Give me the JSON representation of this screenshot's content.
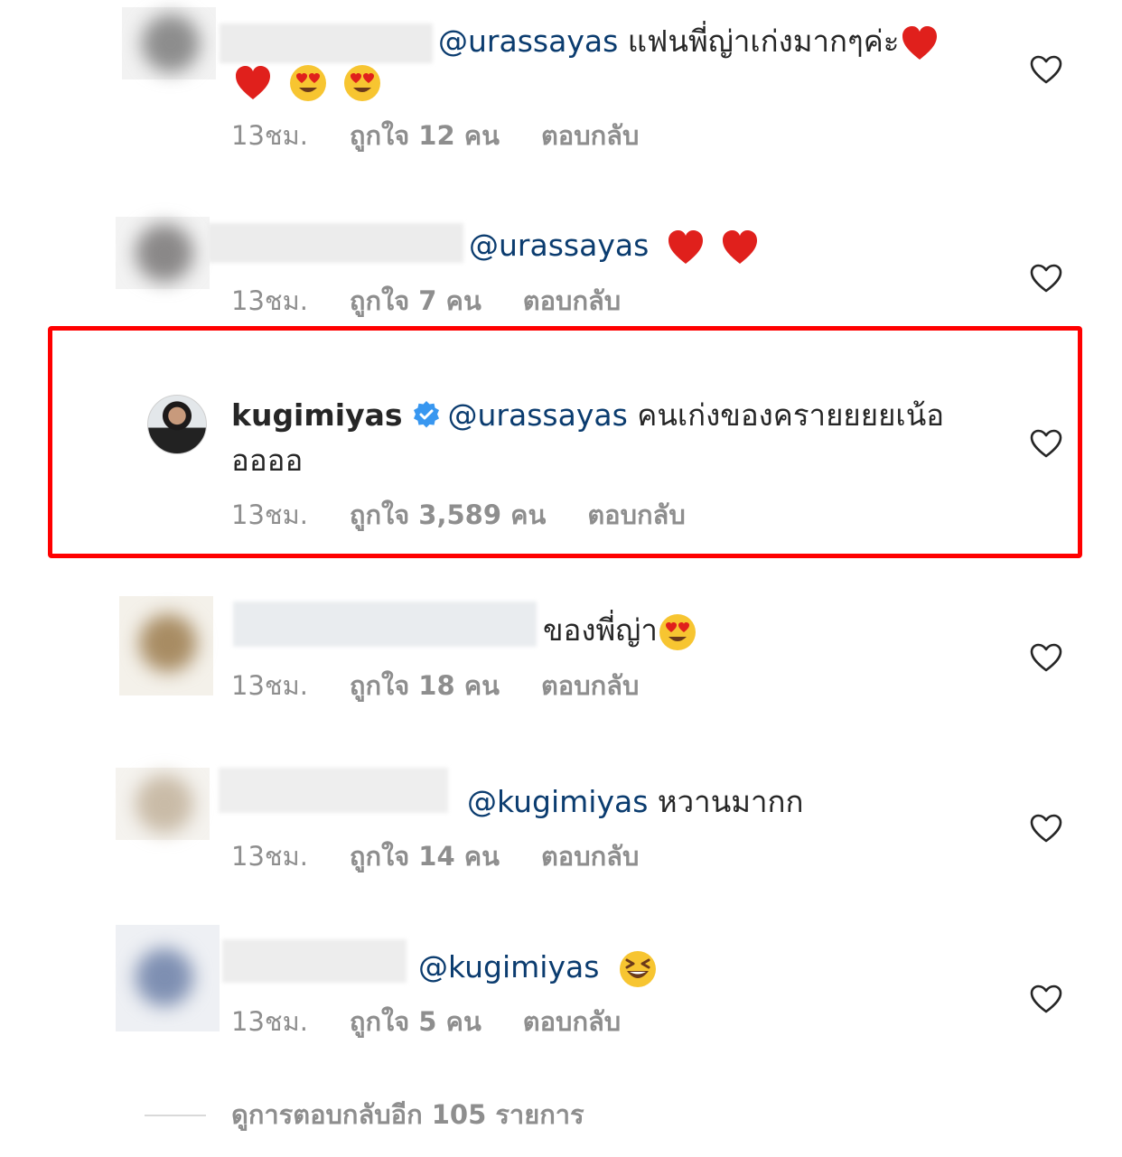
{
  "comments": [
    {
      "mention": "@urassayas",
      "text": " แฟนพี่ญ่าเก่งมากๆค่ะ",
      "time": "13ชม.",
      "likes": "ถูกใจ 12 คน",
      "reply": "ตอบกลับ"
    },
    {
      "mention": "@urassayas",
      "text": "",
      "time": "13ชม.",
      "likes": "ถูกใจ 7 คน",
      "reply": "ตอบกลับ"
    },
    {
      "username": "kugimiyas",
      "mention": "@urassayas",
      "text": " คนเก่งของครายยยยเน้อ",
      "text_line2": "ออออ",
      "time": "13ชม.",
      "likes": "ถูกใจ 3,589 คน",
      "reply": "ตอบกลับ"
    },
    {
      "text": "ของพี่ญ่า",
      "time": "13ชม.",
      "likes": "ถูกใจ 18 คน",
      "reply": "ตอบกลับ"
    },
    {
      "mention": "@kugimiyas",
      "text": " หวานมากก",
      "time": "13ชม.",
      "likes": "ถูกใจ 14 คน",
      "reply": "ตอบกลับ"
    },
    {
      "mention": "@kugimiyas",
      "text": "",
      "time": "13ชม.",
      "likes": "ถูกใจ 5 คน",
      "reply": "ตอบกลับ"
    }
  ],
  "view_more": "ดูการตอบกลับอีก 105 รายการ",
  "colors": {
    "highlight": "#ff0000",
    "mention": "#0b3c6f",
    "meta": "#8e8e8e",
    "verified": "#3897f0"
  }
}
